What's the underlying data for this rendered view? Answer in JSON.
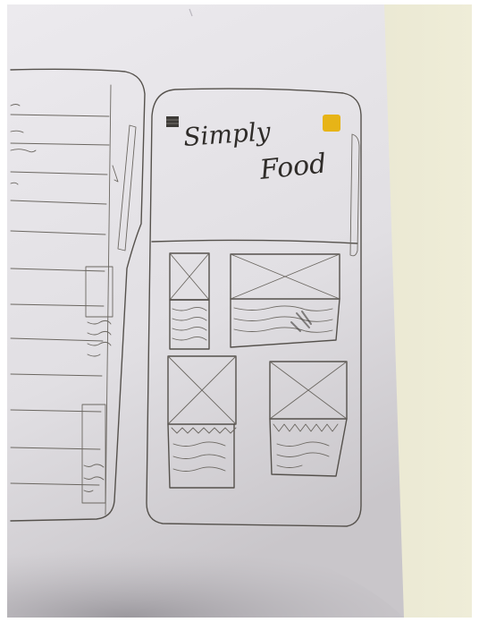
{
  "app_sketch": {
    "title_line1": "Simply",
    "title_line2": "Food"
  },
  "colors": {
    "paper": "#e2e0e4",
    "wall": "#e9e6cf",
    "pencil": "#55514c",
    "sticker": "#e7b417"
  },
  "icons": {
    "logo": "square-logo-icon",
    "sticker": "yellow-square-icon"
  }
}
